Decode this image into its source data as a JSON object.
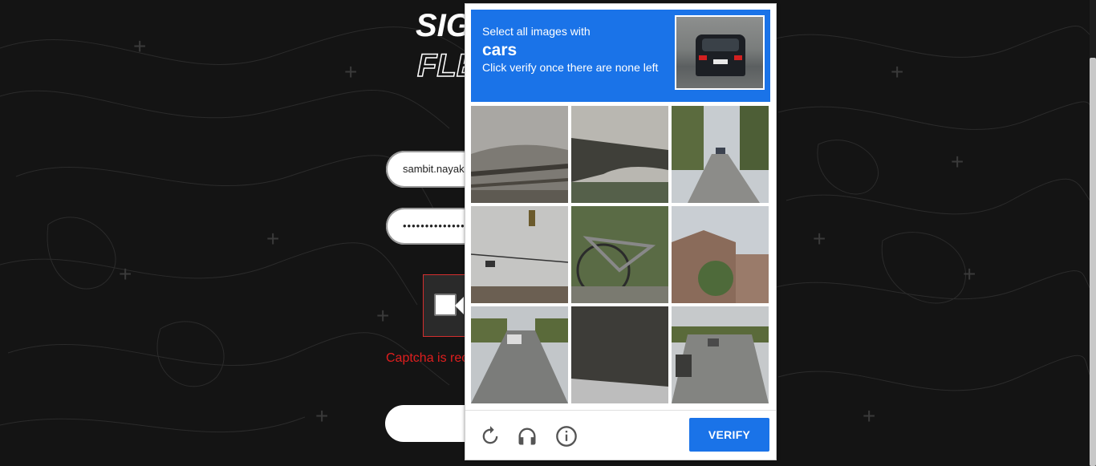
{
  "page": {
    "title_line1": "SIG",
    "title_line2": "FLE",
    "username_value": "sambit.nayak",
    "password_value": "•••••••••••••••",
    "captcha_error": "Captcha is rec"
  },
  "recaptcha": {
    "instruction_line1": "Select all images with",
    "target_object": "cars",
    "instruction_line2": "Click verify once there are none left",
    "verify_label": "VERIFY",
    "tiles": [
      {
        "index": 1,
        "scene": "bridge-railing"
      },
      {
        "index": 2,
        "scene": "overpass"
      },
      {
        "index": 3,
        "scene": "road-with-car"
      },
      {
        "index": 4,
        "scene": "traffic-light"
      },
      {
        "index": 5,
        "scene": "bicycle"
      },
      {
        "index": 6,
        "scene": "house"
      },
      {
        "index": 7,
        "scene": "highway-with-cars"
      },
      {
        "index": 8,
        "scene": "overpass-underside"
      },
      {
        "index": 9,
        "scene": "road-with-cars"
      }
    ],
    "colors": {
      "accent": "#1a73e8",
      "error": "#e01e1e"
    },
    "icons": [
      "reload-icon",
      "headphones-icon",
      "info-icon"
    ]
  }
}
